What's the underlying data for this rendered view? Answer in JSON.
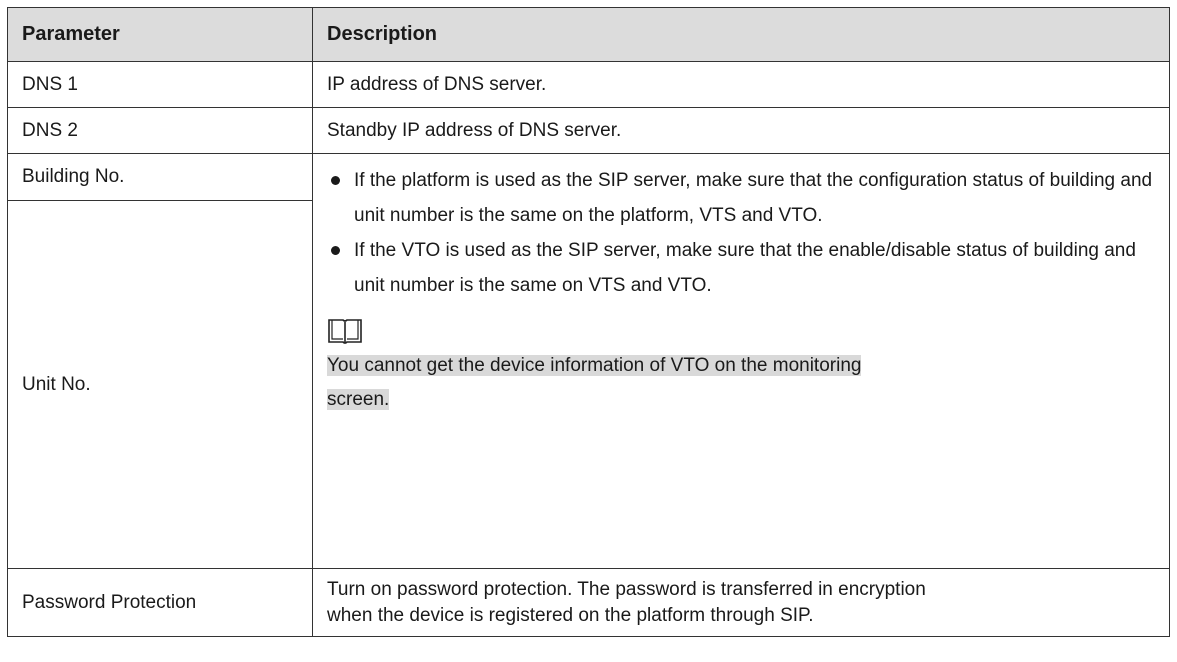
{
  "table": {
    "headers": {
      "parameter": "Parameter",
      "description": "Description"
    },
    "rows": {
      "dns1": {
        "param": "DNS 1",
        "desc": "IP address of DNS server."
      },
      "dns2": {
        "param": "DNS 2",
        "desc": "Standby IP address of DNS server."
      },
      "building": {
        "param": "Building No."
      },
      "unit": {
        "param": "Unit No."
      },
      "building_unit_desc": {
        "bullets": [
          "If the platform is used as the SIP server, make sure that the configuration status of building and unit number is the same on the platform, VTS and VTO.",
          "If the VTO is used as the SIP server, make sure that the enable/disable status of building and unit number is the same on VTS and VTO."
        ],
        "note_icon": "book-icon",
        "note_lines": [
          "You cannot get the device information of VTO on the monitoring",
          "screen."
        ]
      },
      "password": {
        "param": "Password Protection",
        "desc_lines": [
          "Turn on password protection. The password is transferred in encryption",
          "when the device is registered on the platform through SIP."
        ]
      }
    }
  }
}
